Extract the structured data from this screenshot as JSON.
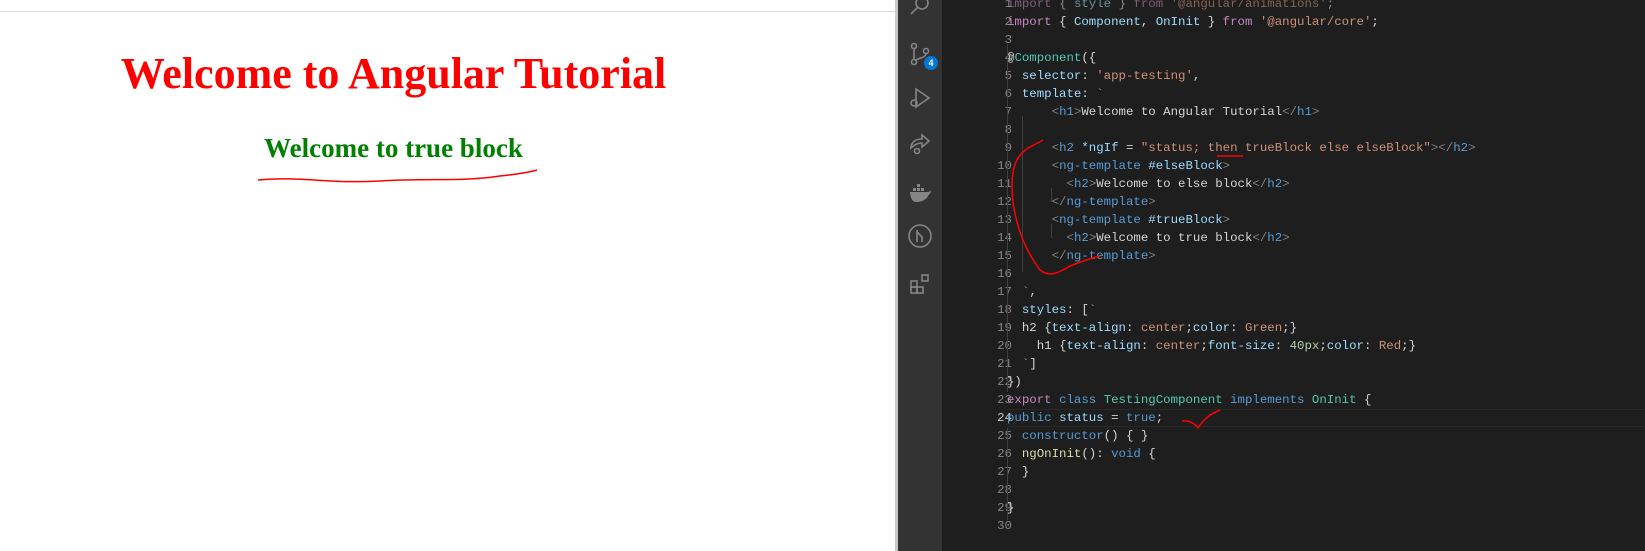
{
  "preview": {
    "h1": "Welcome to Angular Tutorial",
    "h2": "Welcome to true block"
  },
  "activity_bar": {
    "items": [
      {
        "icon": "search-icon"
      },
      {
        "icon": "source-control-icon",
        "badge": "4"
      },
      {
        "icon": "run-debug-icon"
      },
      {
        "icon": "live-share-icon"
      },
      {
        "icon": "docker-icon"
      },
      {
        "icon": "git-graph-icon"
      },
      {
        "icon": "extensions-icon"
      }
    ]
  },
  "editor": {
    "current_line": 24,
    "colors": {
      "keyword": "#c586c0",
      "blue": "#569cd6",
      "string": "#ce9178",
      "variable": "#9cdcfe",
      "type": "#4ec9b0",
      "function": "#dcdcaa",
      "text": "#d4d4d4",
      "punct": "#808080"
    },
    "lines": [
      [
        [
          "import ",
          "k",
          1
        ],
        [
          "{ ",
          "t",
          1
        ],
        [
          "style ",
          "v",
          1
        ],
        [
          "} ",
          "t",
          1
        ],
        [
          "from ",
          "k",
          1
        ],
        [
          "'@angular/animations'",
          "s",
          1
        ],
        [
          ";",
          "t",
          1
        ]
      ],
      [
        [
          "import ",
          "k"
        ],
        [
          "{ ",
          "t"
        ],
        [
          "Component",
          "v"
        ],
        [
          ", ",
          "t"
        ],
        [
          "OnInit",
          "v"
        ],
        [
          " } ",
          "t"
        ],
        [
          "from ",
          "k"
        ],
        [
          "'@angular/core'",
          "s"
        ],
        [
          ";",
          "t"
        ]
      ],
      [],
      [
        [
          "@",
          "t"
        ],
        [
          "Component",
          "y"
        ],
        [
          "({",
          "t"
        ]
      ],
      [
        [
          "  selector",
          "v"
        ],
        [
          ": ",
          "t"
        ],
        [
          "'app-testing'",
          "s"
        ],
        [
          ",",
          "t"
        ]
      ],
      [
        [
          "  template",
          "v"
        ],
        [
          ": ",
          "t"
        ],
        [
          "`",
          "s"
        ]
      ],
      [
        [
          "      ",
          "t"
        ],
        [
          "<",
          "p"
        ],
        [
          "h1",
          "b"
        ],
        [
          ">",
          "p"
        ],
        [
          "Welcome to Angular Tutorial",
          "t"
        ],
        [
          "</",
          "p"
        ],
        [
          "h1",
          "b"
        ],
        [
          ">",
          "p"
        ]
      ],
      [],
      [
        [
          "      ",
          "t"
        ],
        [
          "<",
          "p"
        ],
        [
          "h2 ",
          "b"
        ],
        [
          "*ngIf",
          "v"
        ],
        [
          " = ",
          "t"
        ],
        [
          "\"status; then trueBlock else elseBlock\"",
          "s"
        ],
        [
          "></",
          "p"
        ],
        [
          "h2",
          "b"
        ],
        [
          ">",
          "p"
        ]
      ],
      [
        [
          "      ",
          "t"
        ],
        [
          "<",
          "p"
        ],
        [
          "ng-template ",
          "b"
        ],
        [
          "#elseBlock",
          "v"
        ],
        [
          ">",
          "p"
        ]
      ],
      [
        [
          "        ",
          "t"
        ],
        [
          "<",
          "p"
        ],
        [
          "h2",
          "b"
        ],
        [
          ">",
          "p"
        ],
        [
          "Welcome to else block",
          "t"
        ],
        [
          "</",
          "p"
        ],
        [
          "h2",
          "b"
        ],
        [
          ">",
          "p"
        ]
      ],
      [
        [
          "      ",
          "t"
        ],
        [
          "</",
          "p"
        ],
        [
          "ng-template",
          "b"
        ],
        [
          ">",
          "p"
        ]
      ],
      [
        [
          "      ",
          "t"
        ],
        [
          "<",
          "p"
        ],
        [
          "ng-template ",
          "b"
        ],
        [
          "#trueBlock",
          "v"
        ],
        [
          ">",
          "p"
        ]
      ],
      [
        [
          "        ",
          "t"
        ],
        [
          "<",
          "p"
        ],
        [
          "h2",
          "b"
        ],
        [
          ">",
          "p"
        ],
        [
          "Welcome to true block",
          "t"
        ],
        [
          "</",
          "p"
        ],
        [
          "h2",
          "b"
        ],
        [
          ">",
          "p"
        ]
      ],
      [
        [
          "      ",
          "t"
        ],
        [
          "</",
          "p"
        ],
        [
          "ng-template",
          "b"
        ],
        [
          ">",
          "p"
        ]
      ],
      [],
      [
        [
          "  `",
          "s"
        ],
        [
          ",",
          "t"
        ]
      ],
      [
        [
          "  styles",
          "v"
        ],
        [
          ": [",
          "t"
        ],
        [
          "`",
          "s"
        ]
      ],
      [
        [
          "  h2 ",
          "t"
        ],
        [
          "{",
          "t"
        ],
        [
          "text-align",
          "v"
        ],
        [
          ": ",
          "t"
        ],
        [
          "center",
          "s"
        ],
        [
          ";",
          "t"
        ],
        [
          "color",
          "v"
        ],
        [
          ": ",
          "t"
        ],
        [
          "Green",
          "s"
        ],
        [
          ";}",
          "t"
        ]
      ],
      [
        [
          "    h1 ",
          "t"
        ],
        [
          "{",
          "t"
        ],
        [
          "text-align",
          "v"
        ],
        [
          ": ",
          "t"
        ],
        [
          "center",
          "s"
        ],
        [
          ";",
          "t"
        ],
        [
          "font-size",
          "v"
        ],
        [
          ": ",
          "t"
        ],
        [
          "40px",
          "n"
        ],
        [
          ";",
          "t"
        ],
        [
          "color",
          "v"
        ],
        [
          ": ",
          "t"
        ],
        [
          "Red",
          "s"
        ],
        [
          ";}",
          "t"
        ]
      ],
      [
        [
          "  `",
          "s"
        ],
        [
          "]",
          "t"
        ]
      ],
      [
        [
          "})",
          "t"
        ]
      ],
      [
        [
          "export ",
          "k"
        ],
        [
          "class ",
          "b"
        ],
        [
          "TestingComponent ",
          "y"
        ],
        [
          "implements ",
          "b"
        ],
        [
          "OnInit ",
          "y"
        ],
        [
          "{",
          "t"
        ]
      ],
      [
        [
          "public ",
          "b"
        ],
        [
          "status",
          "v"
        ],
        [
          " = ",
          "t"
        ],
        [
          "true",
          "b"
        ],
        [
          ";",
          "t"
        ]
      ],
      [
        [
          "  constructor",
          "b"
        ],
        [
          "() { }",
          "t"
        ]
      ],
      [
        [
          "  ngOnInit",
          "f"
        ],
        [
          "(): ",
          "t"
        ],
        [
          "void ",
          "b"
        ],
        [
          "{",
          "t"
        ]
      ],
      [
        [
          "  }",
          "t"
        ]
      ],
      [],
      [
        [
          "}",
          "t"
        ]
      ],
      []
    ]
  }
}
